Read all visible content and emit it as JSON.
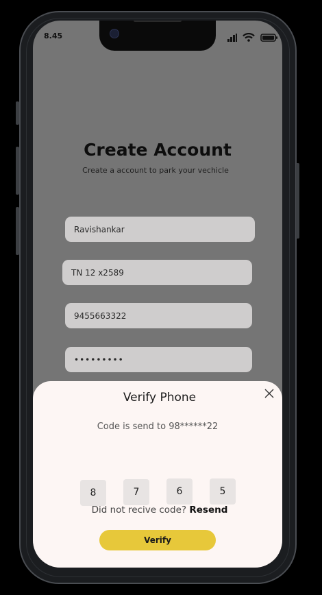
{
  "status_bar": {
    "time": "8.45",
    "icons": [
      "signal-icon",
      "wifi-icon",
      "battery-icon"
    ]
  },
  "create_account": {
    "title": "Create Account",
    "subtitle": "Create a account to park your vechicle",
    "fields": [
      {
        "name": "name-field",
        "value": "Ravishankar"
      },
      {
        "name": "vehicle-number-field",
        "value": "TN 12 x2589"
      },
      {
        "name": "phone-field",
        "value": "9455663322"
      },
      {
        "name": "password-field",
        "value": "•••••••••"
      }
    ]
  },
  "verify_sheet": {
    "title": "Verify Phone",
    "code_sent_text": "Code is send to 98******22",
    "otp_digits": [
      "8",
      "7",
      "6",
      "5"
    ],
    "resend_prompt": "Did not recive code?",
    "resend_label": "Resend",
    "verify_label": "Verify",
    "close_icon": "close-icon"
  },
  "colors": {
    "overlay": "#757575",
    "sheet_background": "#fdf6f4",
    "field_background": "#cfcdcd",
    "otp_box": "#e8e4e3",
    "verify_button": "#e7c83a"
  }
}
